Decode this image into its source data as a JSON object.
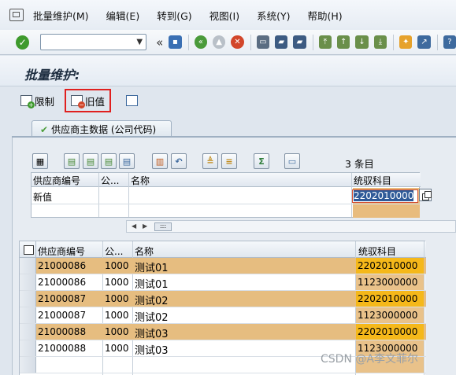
{
  "menu": {
    "items": [
      "批量维护(M)",
      "编辑(E)",
      "转到(G)",
      "视图(I)",
      "系统(Y)",
      "帮助(H)"
    ]
  },
  "toolbar": {
    "command_value": "",
    "nav_back": "«"
  },
  "page": {
    "title": "批量维护:"
  },
  "app_toolbar": {
    "restrict_label": "限制",
    "old_value_label": "旧值"
  },
  "tab": {
    "label": "供应商主数据 (公司代码)"
  },
  "grid": {
    "count_label": "3 条目"
  },
  "input_table": {
    "headers": [
      "供应商编号",
      "公...",
      "名称",
      "统驭科目"
    ],
    "row_label": "新值",
    "new_value": "2202010000"
  },
  "scroll": {
    "thumb": ":::"
  },
  "data_table": {
    "headers": [
      "供应商编号",
      "公...",
      "名称",
      "统驭科目"
    ],
    "rows": [
      {
        "vendor": "21000086",
        "company": "1000",
        "name": "测试01",
        "account": "2202010000",
        "highlight": true
      },
      {
        "vendor": "21000086",
        "company": "1000",
        "name": "测试01",
        "account": "1123000000",
        "highlight": false
      },
      {
        "vendor": "21000087",
        "company": "1000",
        "name": "测试02",
        "account": "2202010000",
        "highlight": true
      },
      {
        "vendor": "21000087",
        "company": "1000",
        "name": "测试02",
        "account": "1123000000",
        "highlight": false
      },
      {
        "vendor": "21000088",
        "company": "1000",
        "name": "测试03",
        "account": "2202010000",
        "highlight": true
      },
      {
        "vendor": "21000088",
        "company": "1000",
        "name": "测试03",
        "account": "1123000000",
        "highlight": false
      }
    ]
  },
  "watermark": "CSDN @A李文菲尔"
}
